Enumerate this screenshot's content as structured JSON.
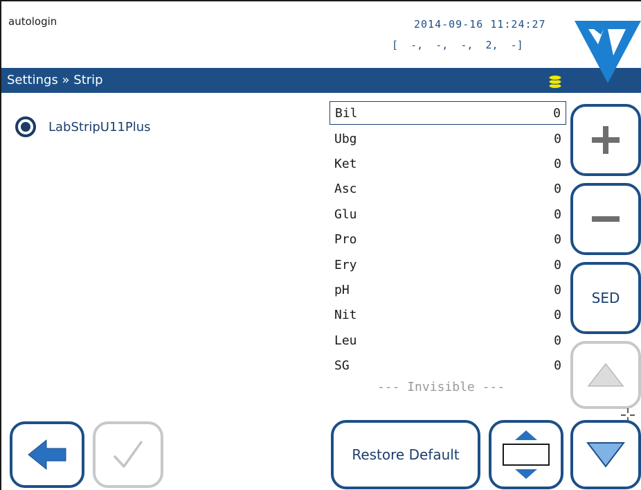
{
  "header": {
    "user": "autologin",
    "datetime": "2014-09-16 11:24:27",
    "status": "[  -,  -,  -,  2,  -]"
  },
  "titlebar": {
    "title": "Settings » Strip",
    "coins_icon": "coins-icon"
  },
  "strip": {
    "label": "LabStripU11Plus",
    "selected": true
  },
  "parameters": [
    {
      "name": "Bil",
      "value": "0"
    },
    {
      "name": "Ubg",
      "value": "0"
    },
    {
      "name": "Ket",
      "value": "0"
    },
    {
      "name": "Asc",
      "value": "0"
    },
    {
      "name": "Glu",
      "value": "0"
    },
    {
      "name": "Pro",
      "value": "0"
    },
    {
      "name": "Ery",
      "value": "0"
    },
    {
      "name": "pH",
      "value": "0"
    },
    {
      "name": "Nit",
      "value": "0"
    },
    {
      "name": "Leu",
      "value": "0"
    },
    {
      "name": "SG",
      "value": "0"
    }
  ],
  "invisible_label": "--- Invisible ---",
  "buttons": {
    "sed": "SED",
    "restore": "Restore Default"
  },
  "colors": {
    "accent": "#1d4f86",
    "disabled": "#c8c8c8",
    "coins": "#f2e600"
  }
}
